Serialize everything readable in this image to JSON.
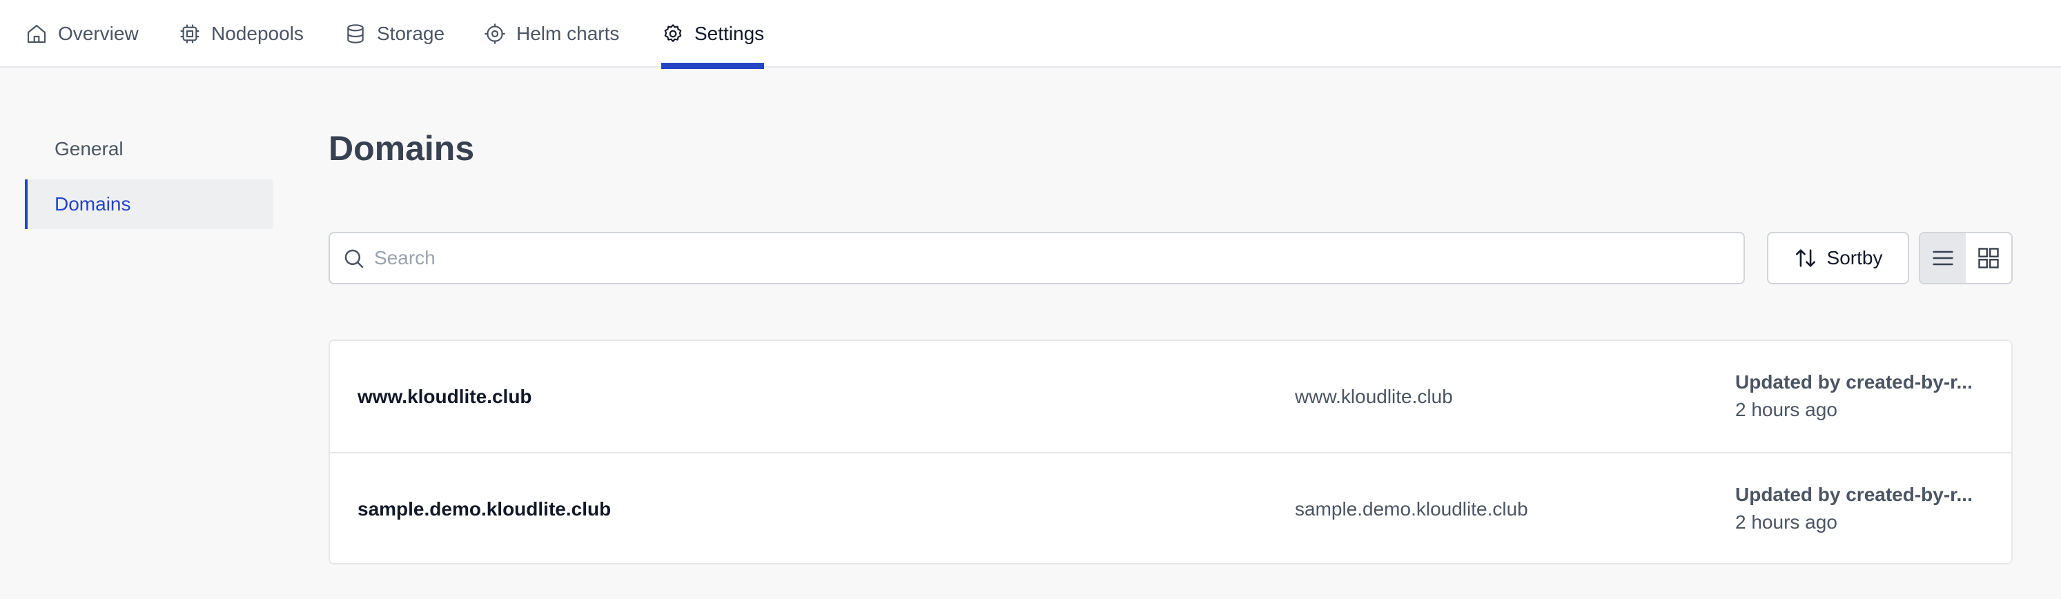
{
  "tabs": [
    {
      "label": "Overview",
      "icon": "home-icon"
    },
    {
      "label": "Nodepools",
      "icon": "cpu-chip-icon"
    },
    {
      "label": "Storage",
      "icon": "database-icon"
    },
    {
      "label": "Helm charts",
      "icon": "crosshair-icon"
    },
    {
      "label": "Settings",
      "icon": "gear-icon",
      "active": true
    }
  ],
  "sidebar": {
    "items": [
      {
        "label": "General"
      },
      {
        "label": "Domains",
        "active": true
      }
    ]
  },
  "main": {
    "title": "Domains",
    "search": {
      "placeholder": "Search",
      "value": ""
    },
    "sort_label": "Sortby",
    "view_mode": "list"
  },
  "domains": [
    {
      "name": "www.kloudlite.club",
      "domain": "www.kloudlite.club",
      "updated_by": "Updated by created-by-r...",
      "time": "2 hours ago"
    },
    {
      "name": "sample.demo.kloudlite.club",
      "domain": "sample.demo.kloudlite.club",
      "updated_by": "Updated by created-by-r...",
      "time": "2 hours ago"
    }
  ],
  "colors": {
    "accent": "#2545c4",
    "background": "#f8f8f8",
    "surface": "#ffffff",
    "border": "#e5e7eb"
  }
}
